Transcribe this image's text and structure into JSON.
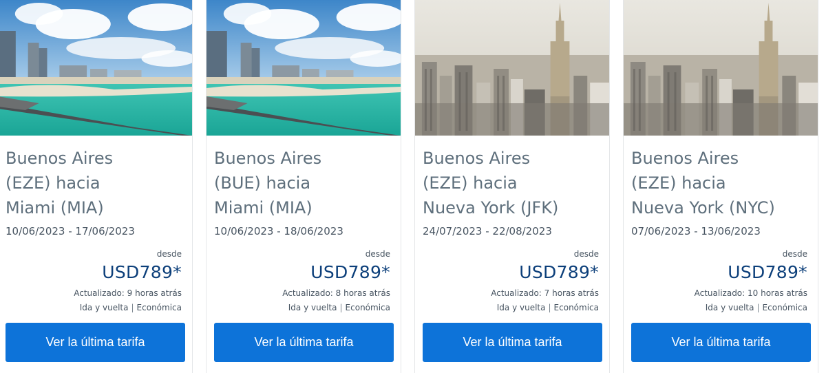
{
  "cards": [
    {
      "image": "miami-beach-photo",
      "route_line1": "Buenos Aires",
      "route_line2": "(EZE) hacia",
      "route_line3": "Miami (MIA)",
      "dates": "10/06/2023 - 17/06/2023",
      "desde": "desde",
      "price": "USD789*",
      "updated": "Actualizado: 9 horas atrás",
      "trip_type": "Ida y vuelta",
      "separator": "|",
      "cabin": "Económica",
      "button": "Ver la última tarifa"
    },
    {
      "image": "miami-beach-photo",
      "route_line1": "Buenos Aires",
      "route_line2": "(BUE) hacia",
      "route_line3": "Miami (MIA)",
      "dates": "10/06/2023 - 18/06/2023",
      "desde": "desde",
      "price": "USD789*",
      "updated": "Actualizado: 8 horas atrás",
      "trip_type": "Ida y vuelta",
      "separator": "|",
      "cabin": "Económica",
      "button": "Ver la última tarifa"
    },
    {
      "image": "new-york-skyline-photo",
      "route_line1": "Buenos Aires",
      "route_line2": "(EZE) hacia",
      "route_line3": "Nueva York (JFK)",
      "dates": "24/07/2023 - 22/08/2023",
      "desde": "desde",
      "price": "USD789*",
      "updated": "Actualizado: 7 horas atrás",
      "trip_type": "Ida y vuelta",
      "separator": "|",
      "cabin": "Económica",
      "button": "Ver la última tarifa"
    },
    {
      "image": "new-york-skyline-photo",
      "route_line1": "Buenos Aires",
      "route_line2": "(EZE) hacia",
      "route_line3": "Nueva York (NYC)",
      "dates": "07/06/2023 - 13/06/2023",
      "desde": "desde",
      "price": "USD789*",
      "updated": "Actualizado: 10 horas atrás",
      "trip_type": "Ida y vuelta",
      "separator": "|",
      "cabin": "Económica",
      "button": "Ver la última tarifa"
    }
  ],
  "colors": {
    "button": "#0d73d9",
    "price": "#0c3f7a",
    "route_text": "#5e6f7c",
    "body_text": "#475461"
  }
}
